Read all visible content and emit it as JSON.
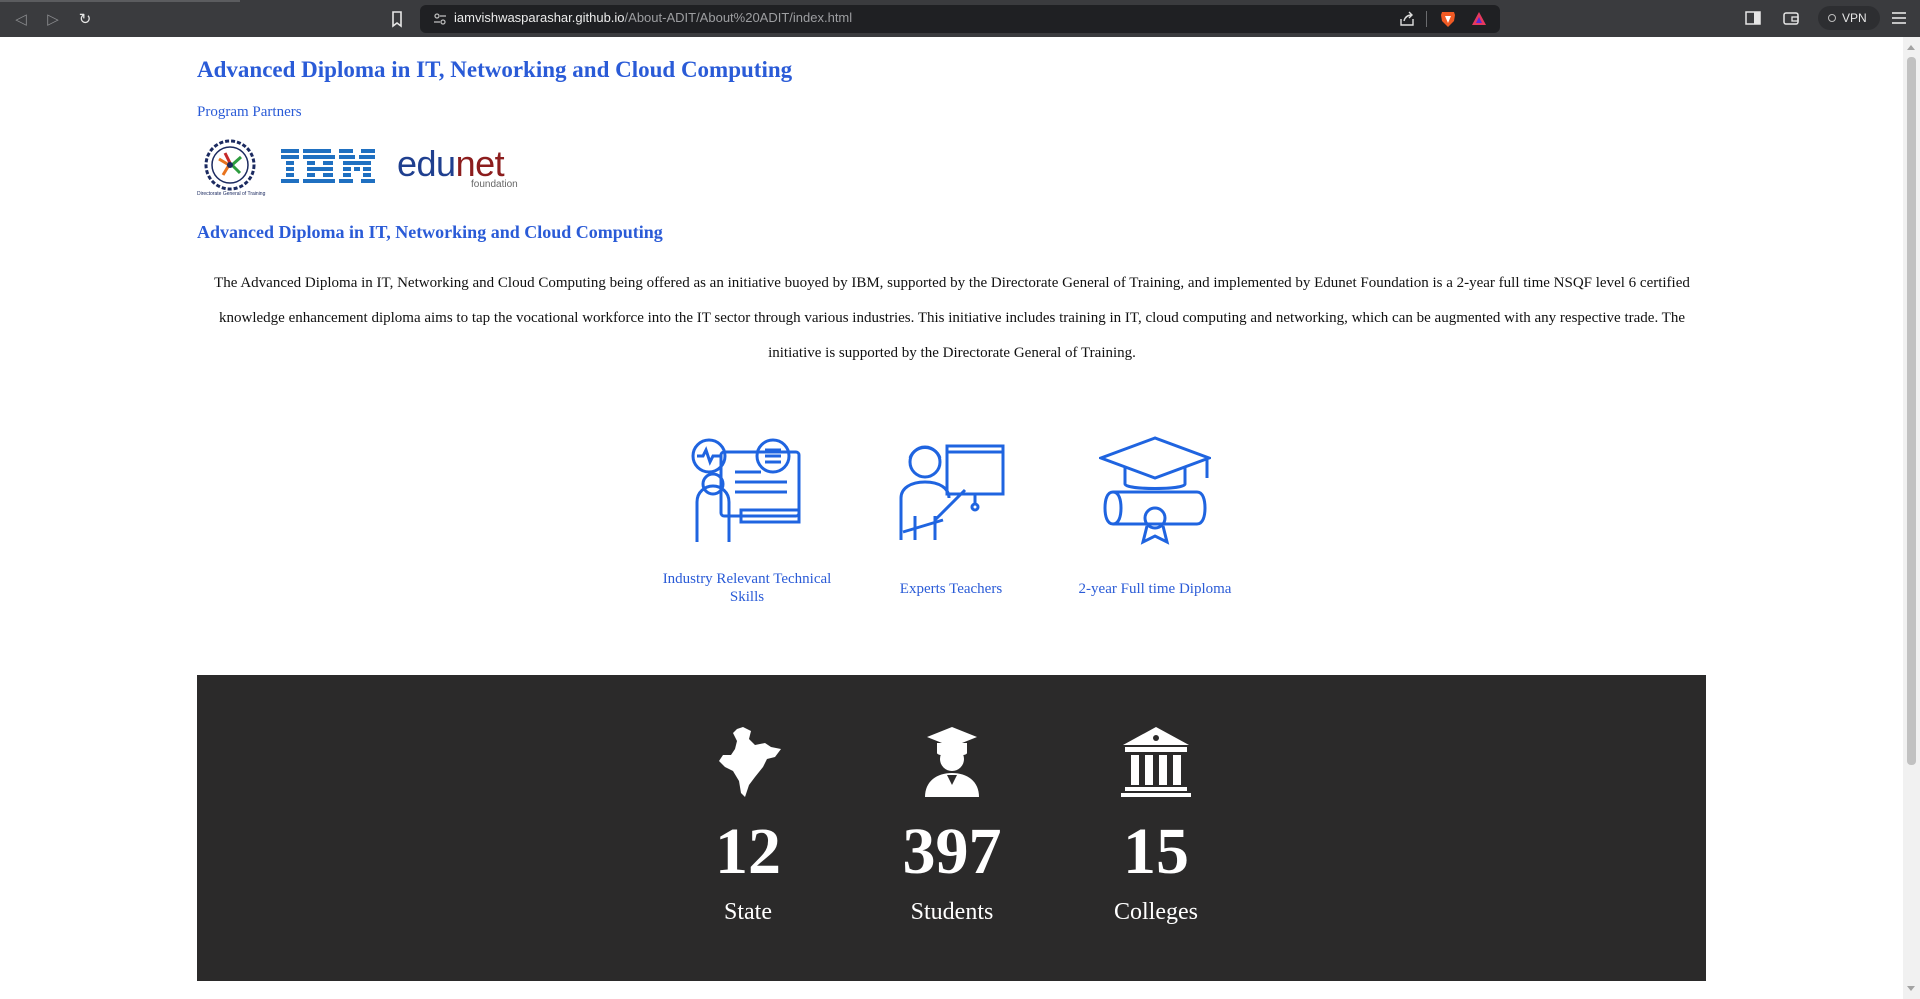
{
  "browser": {
    "url_host": "iamvishwasparashar.github.io",
    "url_path": "/About-ADIT/About%20ADIT/index.html",
    "vpn_label": "VPN"
  },
  "page": {
    "title": "Advanced Diploma in IT, Networking and Cloud Computing",
    "partners_label": "Program Partners",
    "partner_logos": [
      "dgt-logo",
      "ibm-logo",
      "edunet-logo"
    ],
    "dgt_caption": "Directorate General of Training",
    "edunet_text_a": "edu",
    "edunet_text_b": "net",
    "edunet_sub": "foundation",
    "subtitle": "Advanced Diploma in IT, Networking and Cloud Computing",
    "description": "The Advanced Diploma in IT, Networking and Cloud Computing being offered as an initiative buoyed by IBM, supported by the Directorate General of Training, and implemented by Edunet Foundation is a 2-year full time NSQF level 6 certified knowledge enhancement diploma aims to tap the vocational workforce into the IT sector through various industries. This initiative includes training in IT, cloud computing and networking, which can be augmented with any respective trade. The initiative is supported by the Directorate General of Training."
  },
  "features": [
    {
      "label": "Industry Relevant Technical Skills",
      "icon": "technical-skills-icon"
    },
    {
      "label": "Experts Teachers",
      "icon": "teacher-icon"
    },
    {
      "label": "2-year Full time Diploma",
      "icon": "graduation-diploma-icon"
    }
  ],
  "stats": [
    {
      "value": "12",
      "label": "State",
      "icon": "india-map-icon"
    },
    {
      "value": "397",
      "label": "Students",
      "icon": "student-icon"
    },
    {
      "value": "15",
      "label": "Colleges",
      "icon": "college-building-icon"
    }
  ],
  "colors": {
    "accent": "#2a5bd7",
    "stats_bg": "#2b2a2a",
    "chrome_bg": "#3a3b3e"
  }
}
